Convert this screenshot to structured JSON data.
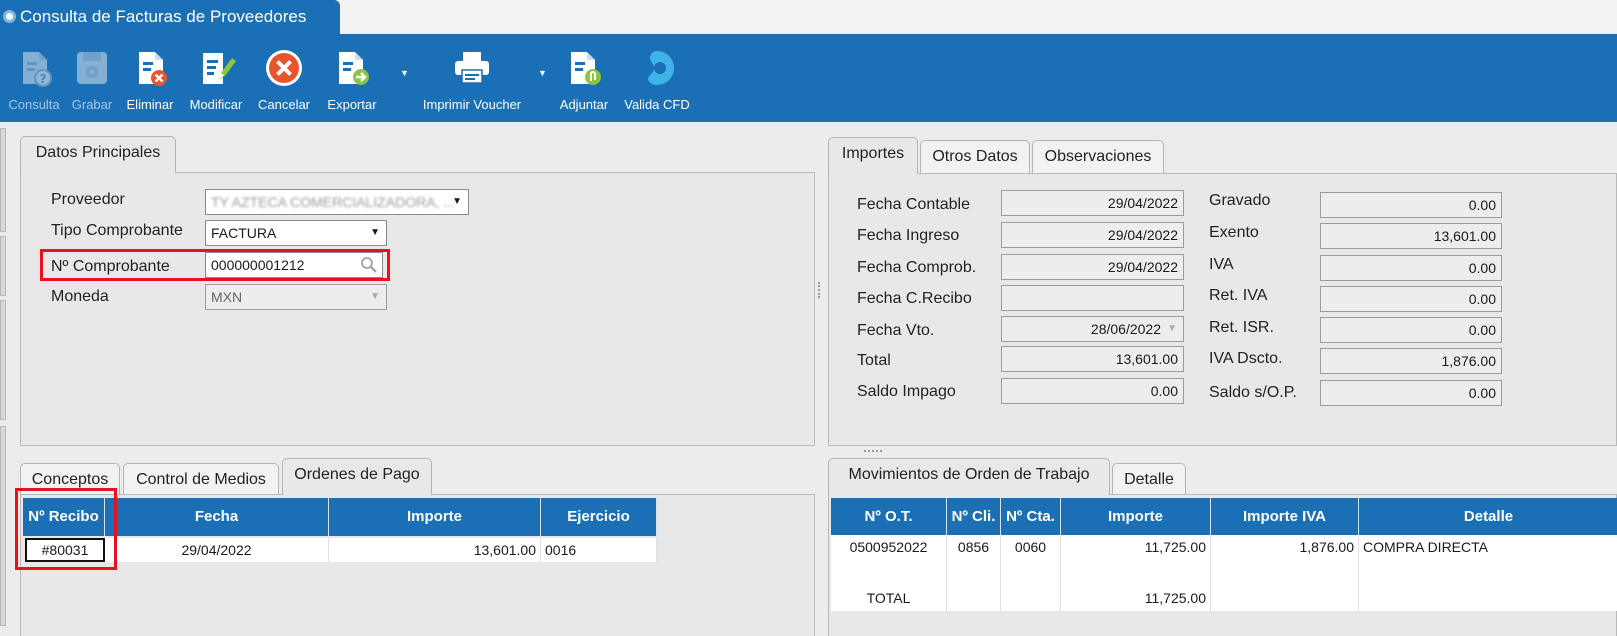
{
  "window": {
    "title": "Consulta de Facturas de Proveedores"
  },
  "toolbar": {
    "consulta": "Consulta",
    "grabar": "Grabar",
    "eliminar": "Eliminar",
    "modificar": "Modificar",
    "cancelar": "Cancelar",
    "exportar": "Exportar",
    "imprimir": "Imprimir Voucher",
    "adjuntar": "Adjuntar",
    "valida": "Valida CFD"
  },
  "datos": {
    "tab": "Datos Principales",
    "proveedor_label": "Proveedor",
    "proveedor_value": "TY AZTECA COMERCIALIZADORA, ...",
    "tipo_label": "Tipo Comprobante",
    "tipo_value": "FACTURA",
    "numero_label": "Nº Comprobante",
    "numero_value": "000000001212",
    "moneda_label": "Moneda",
    "moneda_value": "MXN"
  },
  "importes": {
    "tabs": [
      "Importes",
      "Otros Datos",
      "Observaciones"
    ],
    "left": [
      {
        "label": "Fecha Contable",
        "value": "29/04/2022"
      },
      {
        "label": "Fecha Ingreso",
        "value": "29/04/2022"
      },
      {
        "label": "Fecha Comprob.",
        "value": "29/04/2022"
      },
      {
        "label": "Fecha C.Recibo",
        "value": ""
      },
      {
        "label": "Fecha Vto.",
        "value": "28/06/2022"
      },
      {
        "label": "Total",
        "value": "13,601.00"
      },
      {
        "label": "Saldo Impago",
        "value": "0.00"
      }
    ],
    "right": [
      {
        "label": "Gravado",
        "value": "0.00"
      },
      {
        "label": "Exento",
        "value": "13,601.00"
      },
      {
        "label": "IVA",
        "value": "0.00"
      },
      {
        "label": "Ret. IVA",
        "value": "0.00"
      },
      {
        "label": "Ret. ISR.",
        "value": "0.00"
      },
      {
        "label": "IVA Dscto.",
        "value": "1,876.00"
      },
      {
        "label": "Saldo s/O.P.",
        "value": "0.00"
      }
    ]
  },
  "ordenes": {
    "tabs": [
      "Conceptos",
      "Control de Medios",
      "Ordenes de Pago"
    ],
    "headers": [
      "Nº Recibo",
      "Fecha",
      "Importe",
      "Ejercicio"
    ],
    "rows": [
      [
        "#80031",
        "29/04/2022",
        "13,601.00",
        "0016"
      ]
    ]
  },
  "movimientos": {
    "tabs": [
      "Movimientos de Orden de Trabajo",
      "Detalle"
    ],
    "headers": [
      "Nº O.T.",
      "Nº Cli.",
      "Nº Cta.",
      "Importe",
      "Importe IVA",
      "Detalle"
    ],
    "rows": [
      [
        "0500952022",
        "0856",
        "0060",
        "11,725.00",
        "1,876.00",
        "COMPRA DIRECTA"
      ]
    ],
    "total_label": "TOTAL",
    "total_importe": "11,725.00"
  },
  "colors": {
    "brand": "#1a6fb5",
    "highlight": "#e8121c"
  }
}
